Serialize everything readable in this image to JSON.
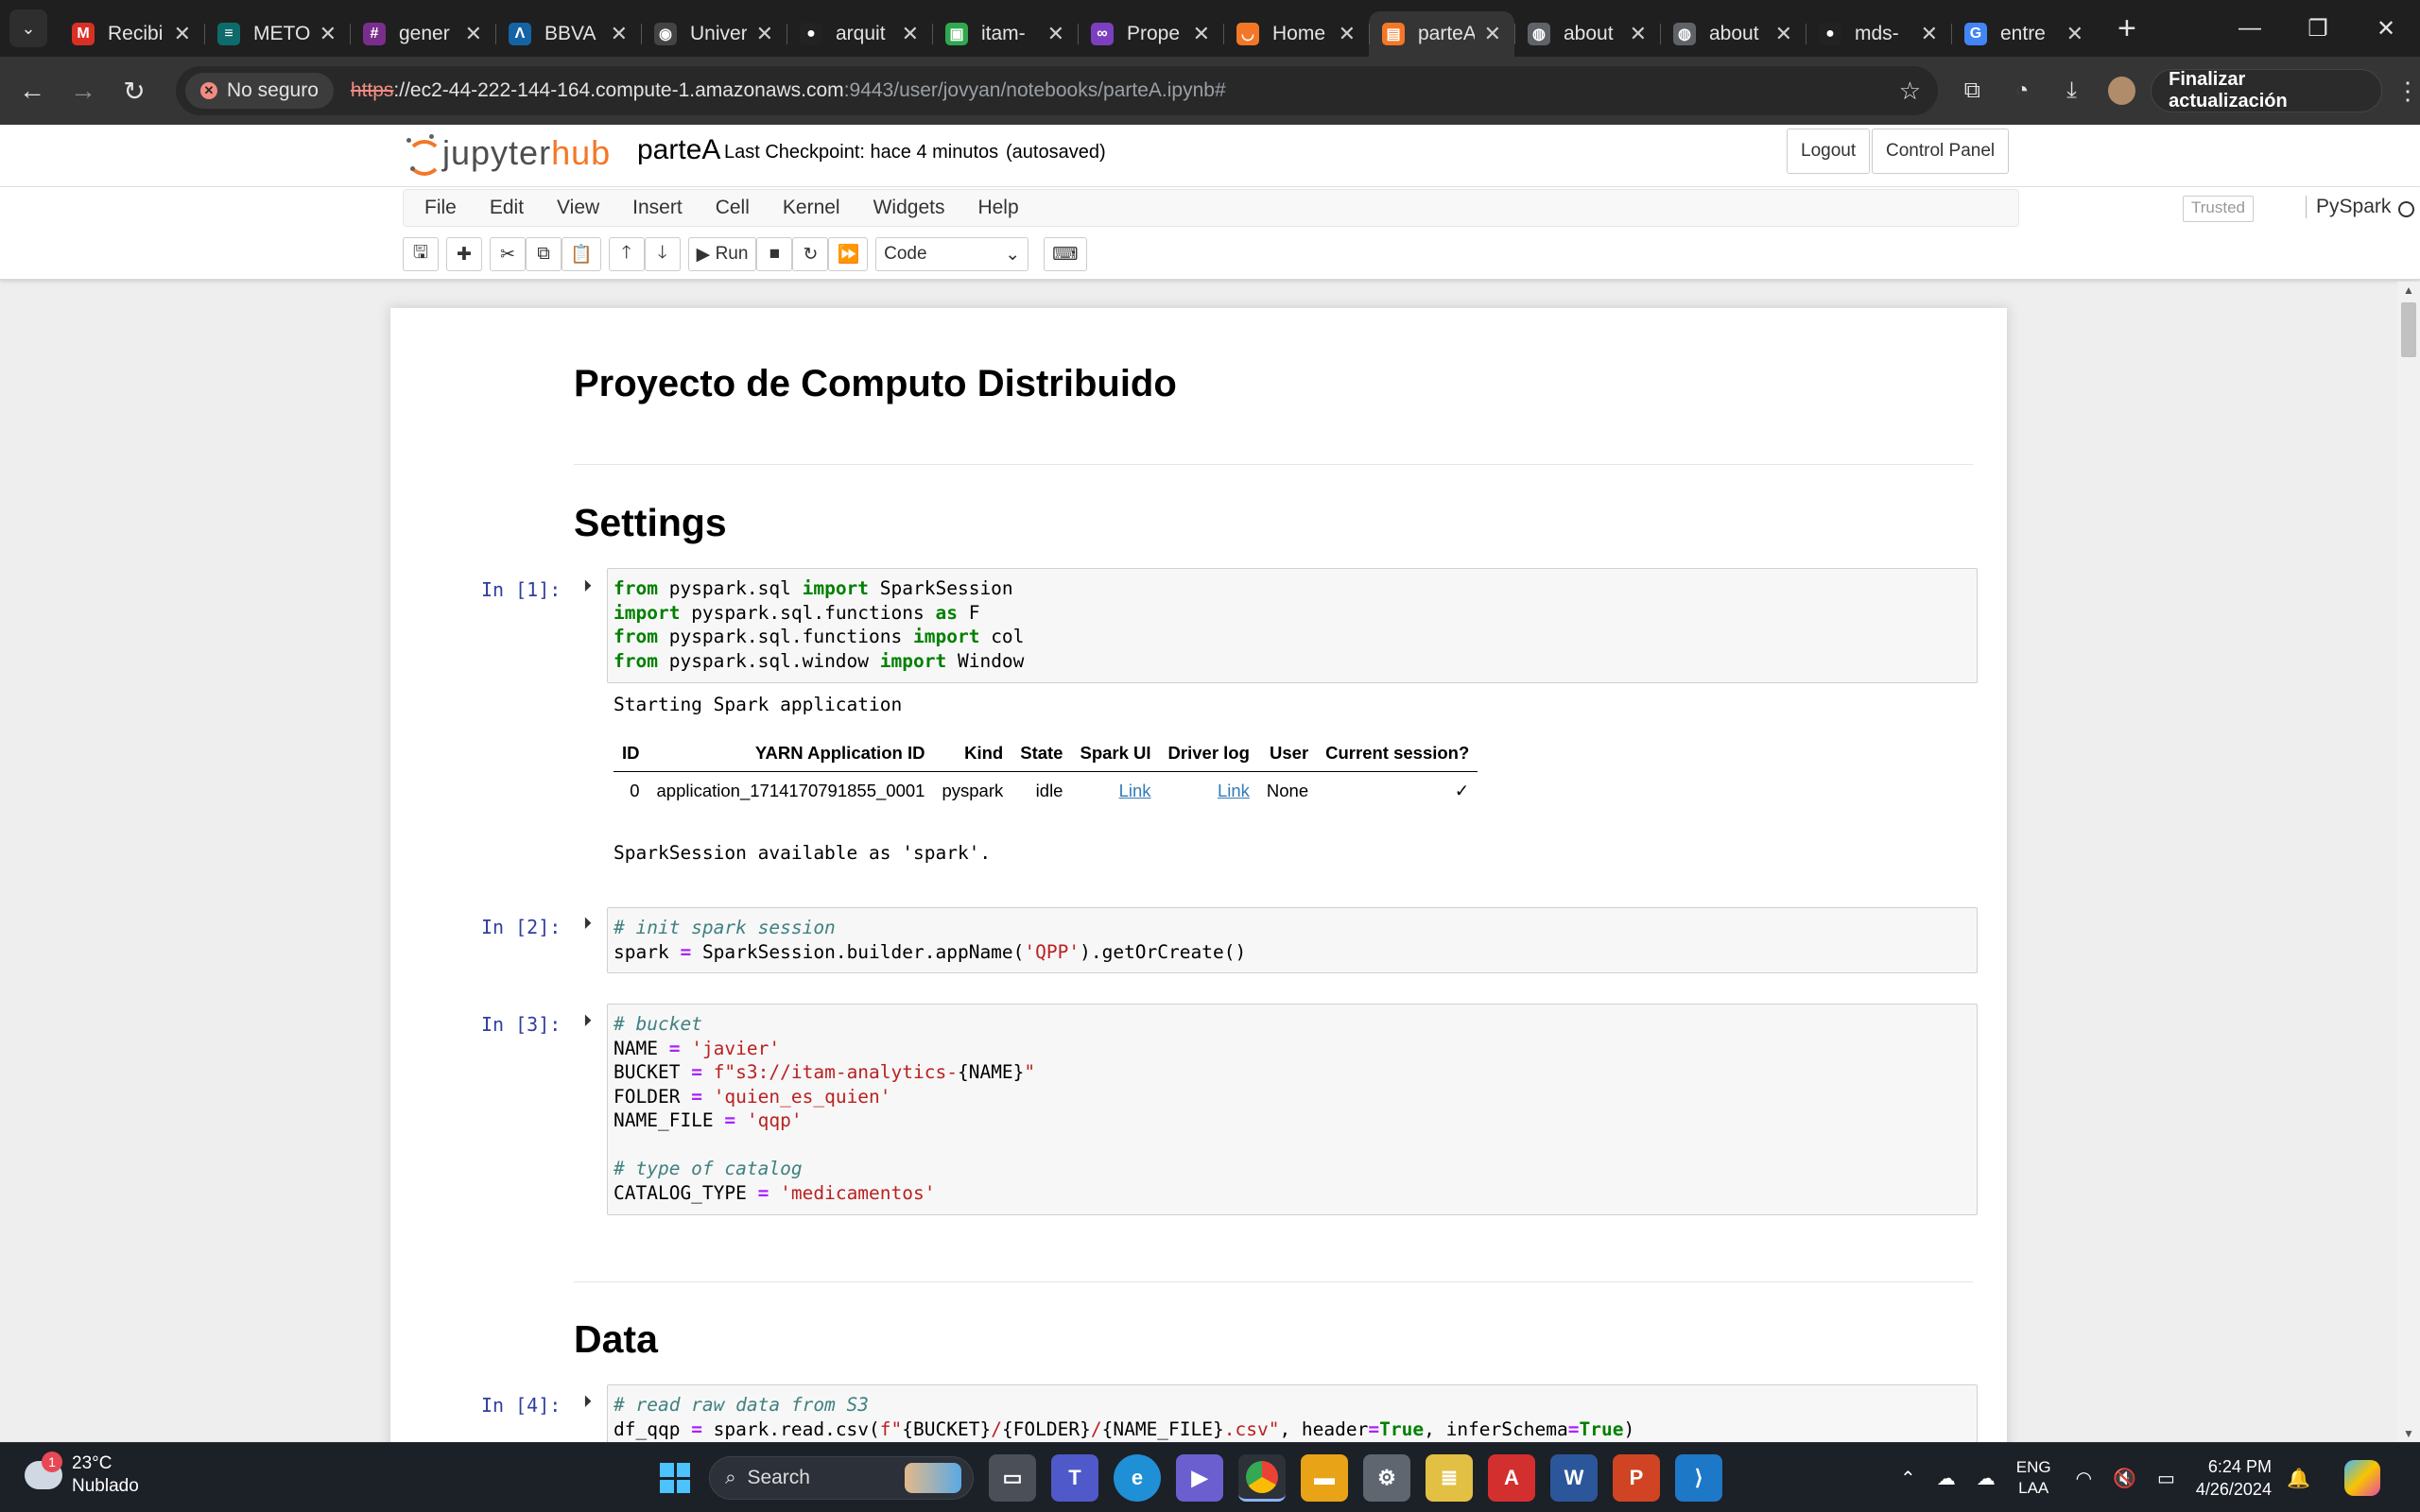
{
  "browser": {
    "tabs": [
      {
        "title": "Recibi",
        "icon": "gmail-icon",
        "color": "#d93025",
        "glyph": "M"
      },
      {
        "title": "METO",
        "icon": "meto-icon",
        "color": "#0f6b6b",
        "glyph": "≡"
      },
      {
        "title": "gener",
        "icon": "slack-icon",
        "color": "#7a2e8c",
        "glyph": "#"
      },
      {
        "title": "BBVA",
        "icon": "bbva-icon",
        "color": "#1464a5",
        "glyph": "Λ"
      },
      {
        "title": "Univer",
        "icon": "university-icon",
        "color": "#444444",
        "glyph": "◉"
      },
      {
        "title": "arquit",
        "icon": "github-icon",
        "color": "#222222",
        "glyph": "●"
      },
      {
        "title": "itam-",
        "icon": "coursera-icon",
        "color": "#2fa84f",
        "glyph": "▣"
      },
      {
        "title": "Prope",
        "icon": "properties-icon",
        "color": "#7b3fbf",
        "glyph": "∞"
      },
      {
        "title": "Home",
        "icon": "jupyterhub-icon",
        "color": "#f37726",
        "glyph": "◡"
      },
      {
        "title": "parteA",
        "icon": "notebook-icon",
        "color": "#f37726",
        "glyph": "▤"
      },
      {
        "title": "about",
        "icon": "globe-icon",
        "color": "#5f6368",
        "glyph": "◍"
      },
      {
        "title": "about",
        "icon": "globe-icon",
        "color": "#5f6368",
        "glyph": "◍"
      },
      {
        "title": "mds-",
        "icon": "github-icon",
        "color": "#222222",
        "glyph": "●"
      },
      {
        "title": "entre",
        "icon": "google-icon",
        "color": "#4285f4",
        "glyph": "G"
      }
    ],
    "active_tab_index": 9,
    "security_label": "No seguro",
    "url_scheme": "https",
    "url_host": "://ec2-44-222-144-164.compute-1.amazonaws.com",
    "url_path": ":9443/user/jovyan/notebooks/parteA.ipynb#",
    "update_button": "Finalizar actualización"
  },
  "jupyter": {
    "logo_left": "jupyter",
    "logo_right": "hub",
    "notebook_name": "parteA",
    "checkpoint": "Last Checkpoint: hace 4 minutos",
    "autosaved": "(autosaved)",
    "logout": "Logout",
    "control_panel": "Control Panel",
    "menus": [
      "File",
      "Edit",
      "View",
      "Insert",
      "Cell",
      "Kernel",
      "Widgets",
      "Help"
    ],
    "trusted": "Trusted",
    "kernel": "PySpark",
    "run_label": "Run",
    "cell_type": "Code"
  },
  "notebook": {
    "title": "Proyecto de Computo Distribuido",
    "section_settings": "Settings",
    "section_data": "Data",
    "prompts": [
      "In [1]:",
      "In [2]:",
      "In [3]:",
      "In [4]:"
    ],
    "output_start": "Starting Spark application",
    "output_session": "SparkSession available as 'spark'.",
    "spark_table": {
      "headers": [
        "ID",
        "YARN Application ID",
        "Kind",
        "State",
        "Spark UI",
        "Driver log",
        "User",
        "Current session?"
      ],
      "row": [
        "0",
        "application_1714170791855_0001",
        "pyspark",
        "idle",
        "Link",
        "Link",
        "None",
        "✓"
      ]
    }
  },
  "taskbar": {
    "temperature": "23°C",
    "weather": "Nublado",
    "weather_badge": "1",
    "search_placeholder": "Search",
    "language_top": "ENG",
    "language_bottom": "LAA",
    "time": "6:24 PM",
    "date": "4/26/2024"
  }
}
